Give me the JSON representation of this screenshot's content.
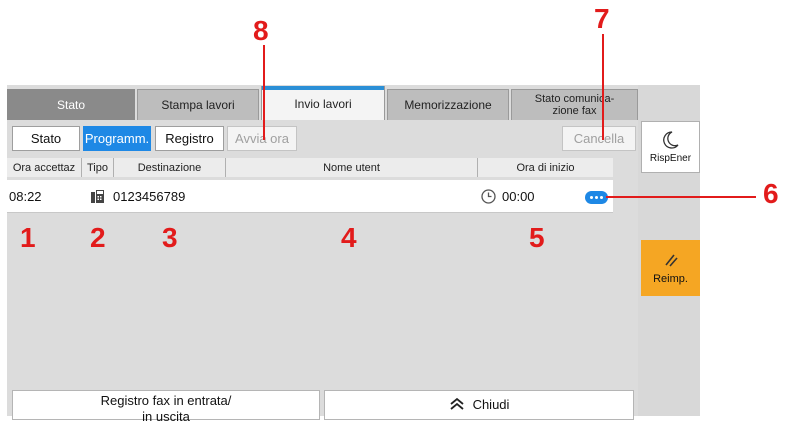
{
  "tabs": [
    {
      "label": "Stato"
    },
    {
      "label": "Stampa lavori"
    },
    {
      "label": "Invio lavori"
    },
    {
      "label": "Memorizzazione"
    },
    {
      "label": "Stato comunica-\nzione fax"
    }
  ],
  "toolbar": {
    "stato": "Stato",
    "programm": "Programm.",
    "registro": "Registro",
    "avvia_ora": "Avvia ora",
    "cancella": "Cancella"
  },
  "columns": [
    "Ora accettaz",
    "Tipo",
    "Destinazione",
    "Nome utent",
    "Ora di inizio"
  ],
  "rows": [
    {
      "time": "08:22",
      "type_icon": "fax-icon",
      "destination": "0123456789",
      "user": "",
      "start_icon": "clock-icon",
      "start": "00:00",
      "more_icon": "ellipsis-icon"
    }
  ],
  "side": {
    "energy_label": "RispEner",
    "energy_icon": "moon-icon",
    "reset_label": "Reimp.",
    "reset_icon": "reset-icon"
  },
  "bottom": {
    "fax_log": "Registro fax in entrata/\nin uscita",
    "close": "Chiudi",
    "close_icon": "chevrons-up-icon"
  },
  "callouts": {
    "c1": "1",
    "c2": "2",
    "c3": "3",
    "c4": "4",
    "c5": "5",
    "c6": "6",
    "c7": "7",
    "c8": "8"
  },
  "colors": {
    "accent": "#1e88e5",
    "callout": "#e21b1b",
    "reset_bg": "#f5a623"
  }
}
